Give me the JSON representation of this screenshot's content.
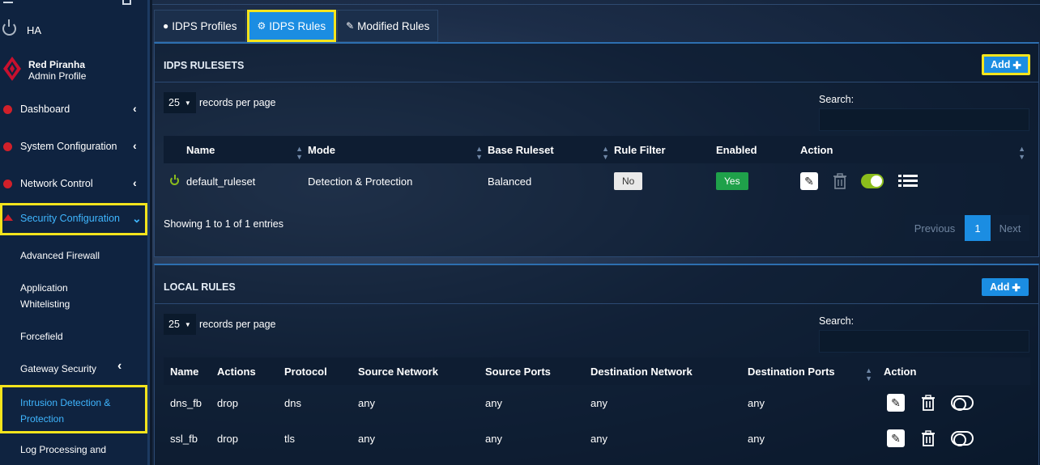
{
  "sidebar": {
    "ha_label": "HA",
    "profile_name": "Red Piranha",
    "profile_role": "Admin Profile",
    "items": [
      {
        "label": "Dashboard"
      },
      {
        "label": "System Configuration"
      },
      {
        "label": "Network Control"
      },
      {
        "label": "Security Configuration"
      }
    ],
    "subitems": [
      {
        "label": "Advanced Firewall"
      },
      {
        "label": "Application"
      },
      {
        "label": "Whitelisting"
      },
      {
        "label": "Forcefield"
      },
      {
        "label": "Gateway Security"
      },
      {
        "label": "Intrusion Detection &"
      },
      {
        "label": "Protection"
      },
      {
        "label": "Log Processing and"
      }
    ]
  },
  "tabs": [
    {
      "label": "IDPS Profiles",
      "icon": "globe-icon"
    },
    {
      "label": "IDPS Rules",
      "icon": "gears-icon"
    },
    {
      "label": "Modified Rules",
      "icon": "pencil-icon"
    }
  ],
  "rulesets": {
    "title": "IDPS RULESETS",
    "add_label": "Add",
    "page_length": "25",
    "records_per_page": "records per page",
    "search_label": "Search:",
    "columns": [
      "Name",
      "Mode",
      "Base Ruleset",
      "Rule Filter",
      "Enabled",
      "Action"
    ],
    "rows": [
      {
        "name": "default_ruleset",
        "mode": "Detection & Protection",
        "base": "Balanced",
        "rule_filter": "No",
        "enabled": "Yes"
      }
    ],
    "showing": "Showing 1 to 1 of 1 entries",
    "pager": {
      "prev": "Previous",
      "current": "1",
      "next": "Next"
    }
  },
  "local": {
    "title": "LOCAL RULES",
    "add_label": "Add",
    "page_length": "25",
    "records_per_page": "records per page",
    "search_label": "Search:",
    "columns": [
      "Name",
      "Actions",
      "Protocol",
      "Source Network",
      "Source Ports",
      "Destination Network",
      "Destination Ports",
      "Action"
    ],
    "rows": [
      {
        "name": "dns_fb",
        "action": "drop",
        "protocol": "dns",
        "src_net": "any",
        "src_ports": "any",
        "dst_net": "any",
        "dst_ports": "any"
      },
      {
        "name": "ssl_fb",
        "action": "drop",
        "protocol": "tls",
        "src_net": "any",
        "src_ports": "any",
        "dst_net": "any",
        "dst_ports": "any"
      }
    ]
  },
  "colors": {
    "accent": "#1b8de2",
    "highlight": "#f4e41c",
    "enabled": "#1fa14a",
    "toggle_on": "#8bbd1c"
  }
}
